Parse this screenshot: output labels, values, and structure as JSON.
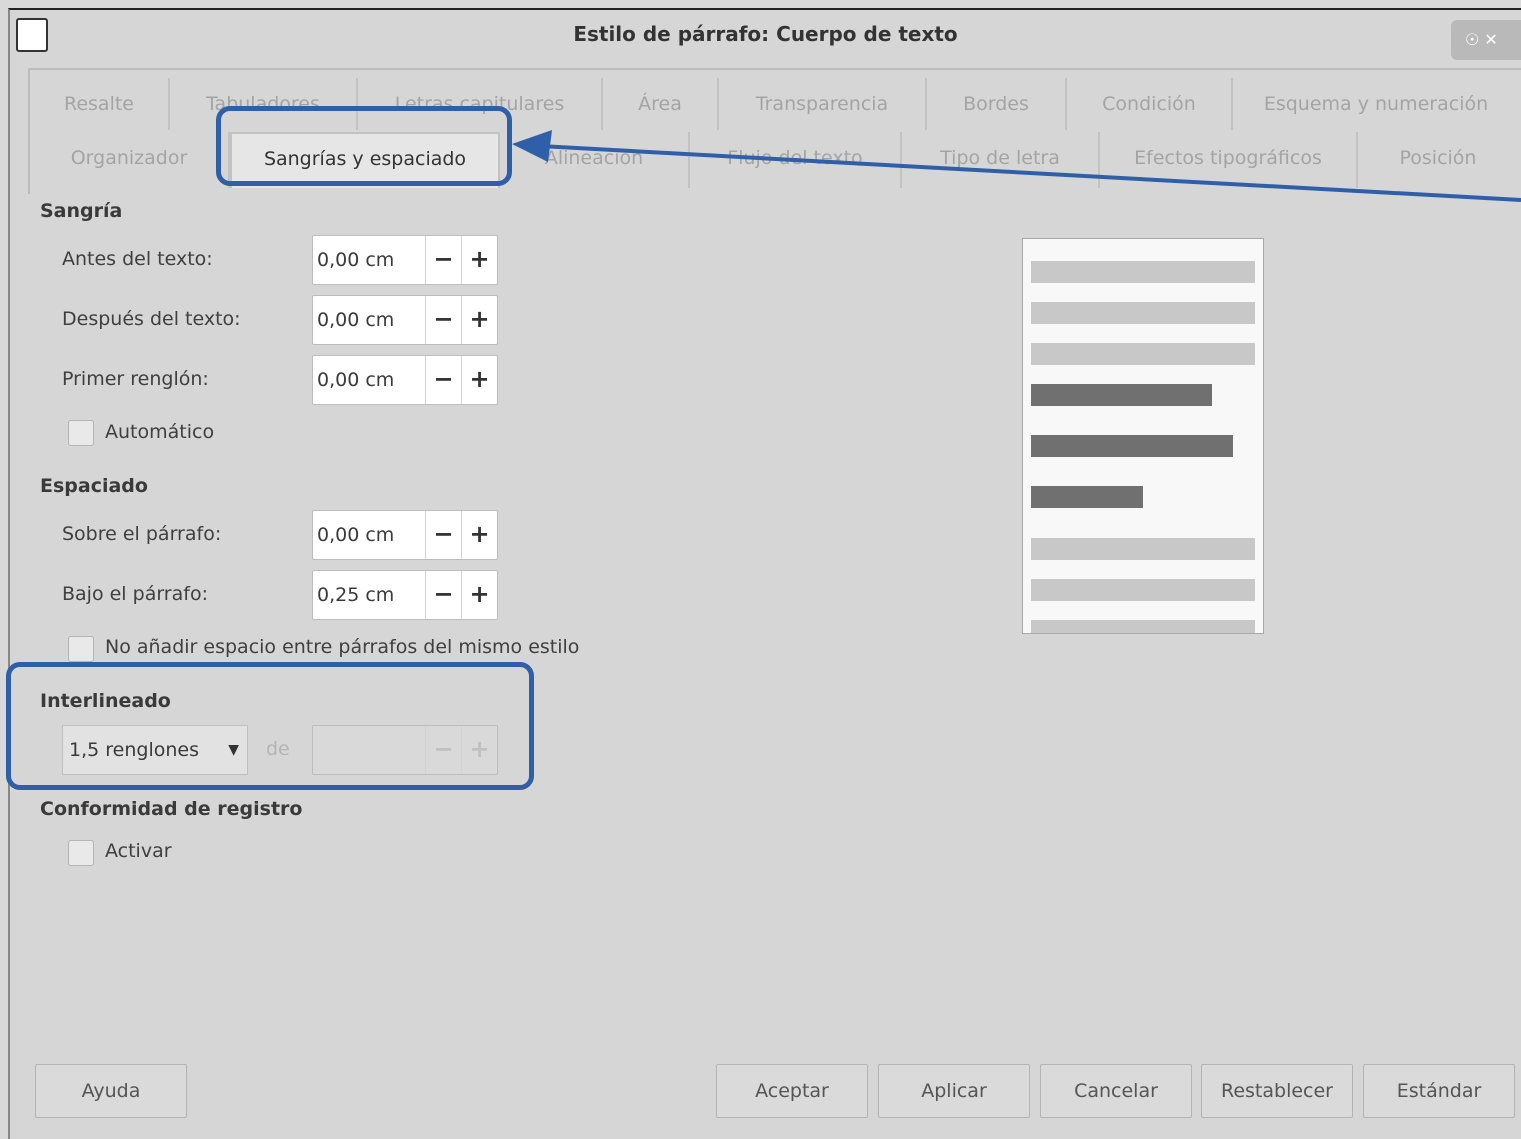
{
  "window": {
    "title": "Estilo de párrafo: Cuerpo de texto",
    "controls": "☉ ✕"
  },
  "tabs_row1": [
    "Resalte",
    "Tabuladores",
    "Letras capitulares",
    "Área",
    "Transparencia",
    "Bordes",
    "Condición",
    "Esquema y numeración"
  ],
  "tabs_row2": [
    "Organizador",
    "Sangrías y espaciado",
    "Alineación",
    "Flujo del texto",
    "Tipo de letra",
    "Efectos tipográficos",
    "Posición"
  ],
  "active_tab": "Sangrías y espaciado",
  "sangria": {
    "heading": "Sangría",
    "antes_label": "Antes del texto:",
    "antes_value": "0,00 cm",
    "despues_label": "Después del texto:",
    "despues_value": "0,00 cm",
    "primer_label": "Primer renglón:",
    "primer_value": "0,00 cm",
    "automatico_label": "Automático"
  },
  "espaciado": {
    "heading": "Espaciado",
    "sobre_label": "Sobre el párrafo:",
    "sobre_value": "0,00 cm",
    "bajo_label": "Bajo el párrafo:",
    "bajo_value": "0,25 cm",
    "no_anadir_label": "No añadir espacio entre párrafos del mismo estilo"
  },
  "interlineado": {
    "heading": "Interlineado",
    "selected": "1,5 renglones",
    "de_label": "de",
    "value": ""
  },
  "conformidad": {
    "heading": "Conformidad de registro",
    "activar_label": "Activar"
  },
  "spin_minus": "−",
  "spin_plus": "+",
  "buttons": {
    "ayuda": "Ayuda",
    "aceptar": "Aceptar",
    "aplicar": "Aplicar",
    "cancelar": "Cancelar",
    "restablecer": "Restablecer",
    "estandar": "Estándar"
  },
  "colors": {
    "highlight": "#2f5fa8",
    "preview_light": "#c8c8c8",
    "preview_dark": "#707070"
  }
}
